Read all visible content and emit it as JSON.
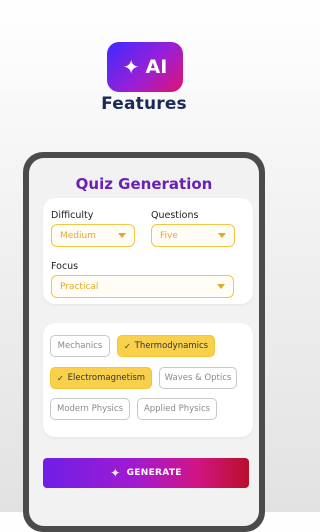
{
  "header": {
    "app_icon_text": "AI",
    "app_icon_glyph": "✦",
    "features_label": "Features"
  },
  "screen": {
    "title": "Quiz Generation",
    "difficulty": {
      "label": "Difficulty",
      "value": "Medium"
    },
    "questions": {
      "label": "Questions",
      "value": "Five"
    },
    "focus": {
      "label": "Focus",
      "value": "Practical"
    },
    "topics": [
      {
        "label": "Mechanics",
        "selected": false
      },
      {
        "label": "Thermodynamics",
        "selected": true
      },
      {
        "label": "Electromagnetism",
        "selected": true
      },
      {
        "label": "Waves & Optics",
        "selected": false
      },
      {
        "label": "Modern Physics",
        "selected": false
      },
      {
        "label": "Applied Physics",
        "selected": false
      }
    ],
    "check_glyph": "✓",
    "generate_label": "GENERATE",
    "generate_glyph": "✦"
  },
  "colors": {
    "accent_yellow": "#f9d04c",
    "title_purple": "#6a1fb5",
    "features_navy": "#1c2a56"
  }
}
